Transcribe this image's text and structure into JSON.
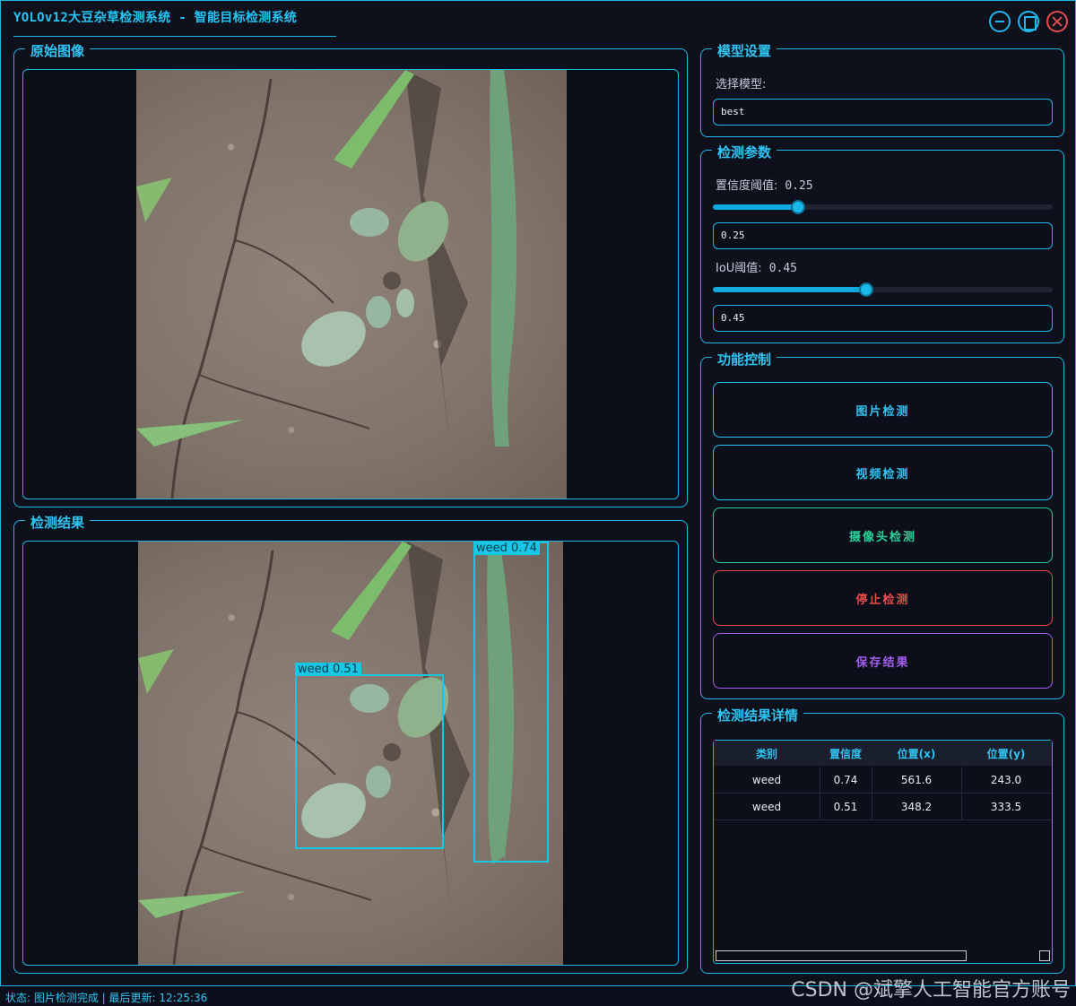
{
  "window": {
    "title": "YOLOv12大豆杂草检测系统 - 智能目标检测系统"
  },
  "panels": {
    "original": {
      "title": "原始图像"
    },
    "result": {
      "title": "检测结果"
    }
  },
  "detections_overlay": [
    {
      "label": "weed 0.74"
    },
    {
      "label": "weed 0.51"
    }
  ],
  "model": {
    "title": "模型设置",
    "select_label": "选择模型:",
    "selected": "best"
  },
  "params": {
    "title": "检测参数",
    "conf_label": "置信度阈值:",
    "conf_value": "0.25",
    "conf_level": 0.25,
    "conf_input": "0.25",
    "iou_label": "IoU阈值:",
    "iou_value": "0.45",
    "iou_level": 0.45,
    "iou_input": "0.45"
  },
  "controls": {
    "title": "功能控制",
    "image_detect": "图片检测",
    "video_detect": "视频检测",
    "camera_detect": "摄像头检测",
    "stop_detect": "停止检测",
    "save_result": "保存结果",
    "colors": {
      "image": "#2fc4f2",
      "video": "#2fc4f2",
      "camera": "#2ad29a",
      "stop": "#ef4b4b",
      "save": "#a35df0"
    }
  },
  "results": {
    "title": "检测结果详情",
    "columns": [
      "类别",
      "置信度",
      "位置(x)",
      "位置(y)"
    ],
    "rows": [
      [
        "weed",
        "0.74",
        "561.6",
        "243.0"
      ],
      [
        "weed",
        "0.51",
        "348.2",
        "333.5"
      ]
    ]
  },
  "status": {
    "text": "状态: 图片检测完成 | 最后更新: 12:25:36"
  },
  "watermark": "CSDN @斌擎人工智能官方账号"
}
